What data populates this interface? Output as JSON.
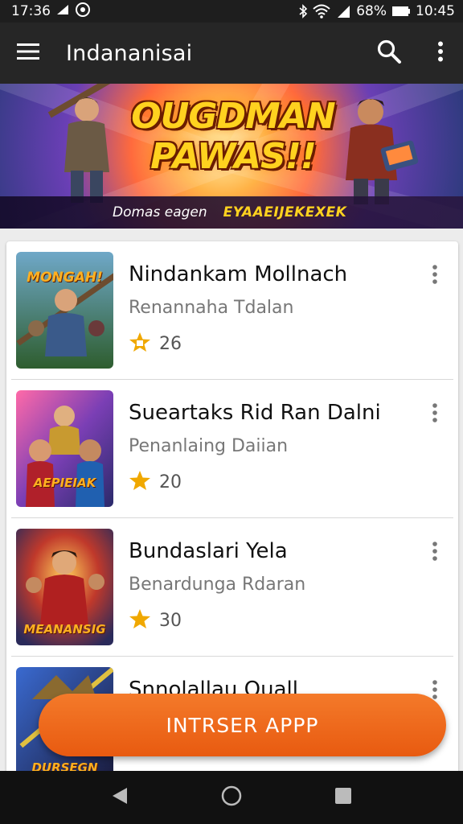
{
  "status_bar": {
    "time_left": "17:36",
    "battery": "68%",
    "time_right": "10:45"
  },
  "app_bar": {
    "title": "Indananisai",
    "menu_icon": "hamburger-menu-icon",
    "search_icon": "search-icon",
    "overflow_icon": "more-vert-icon"
  },
  "banner": {
    "title_line1": "OUGDMAN",
    "title_line2": "PAWAS!!",
    "subtitle": "Domas eagen",
    "tagline": "EYAAEIJEKEXEK"
  },
  "games": [
    {
      "title": "Nindankam Mollnach",
      "subtitle": "Renannaha Tdalan",
      "rating": "26",
      "thumb_text": "MONGAH!",
      "accent": "#2e7d32"
    },
    {
      "title": "Sueartaks  Rid Ran Dalni",
      "subtitle": "Penanlaing Daiian",
      "rating": "20",
      "thumb_text": "AEPIEIAK",
      "accent": "#7b1fa2"
    },
    {
      "title": "Bundaslari Yela",
      "subtitle": "Benardunga Rdaran",
      "rating": "30",
      "thumb_text": "MEANANSIG",
      "accent": "#c62828"
    },
    {
      "title": "Snnolallau Quall",
      "subtitle": "",
      "rating": "",
      "thumb_text": "DURSEGN",
      "accent": "#283593"
    }
  ],
  "install_button": {
    "label": "INTRSER APPP",
    "color": "#ee6a1e"
  },
  "nav": {
    "back_icon": "back-triangle-icon",
    "home_icon": "home-circle-icon",
    "recents_icon": "recents-square-icon"
  },
  "colors": {
    "app_bar": "#262626",
    "status_bar": "#1e1e1e",
    "accent_orange": "#ee6a1e",
    "star": "#f0a800"
  }
}
